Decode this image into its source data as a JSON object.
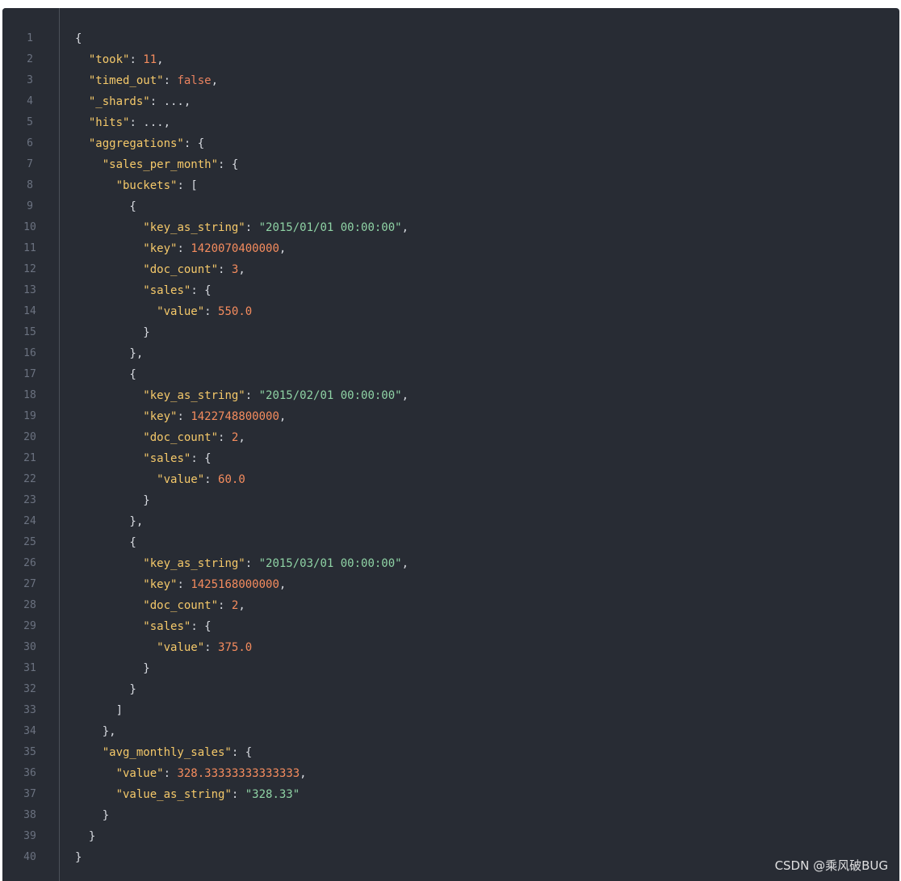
{
  "code_block": {
    "lines": [
      [
        {
          "t": "{",
          "c": "punct"
        }
      ],
      [
        {
          "t": "  ",
          "c": "punct"
        },
        {
          "t": "\"took\"",
          "c": "key"
        },
        {
          "t": ": ",
          "c": "punct"
        },
        {
          "t": "11",
          "c": "num"
        },
        {
          "t": ",",
          "c": "punct"
        }
      ],
      [
        {
          "t": "  ",
          "c": "punct"
        },
        {
          "t": "\"timed_out\"",
          "c": "key"
        },
        {
          "t": ": ",
          "c": "punct"
        },
        {
          "t": "false",
          "c": "bool"
        },
        {
          "t": ",",
          "c": "punct"
        }
      ],
      [
        {
          "t": "  ",
          "c": "punct"
        },
        {
          "t": "\"_shards\"",
          "c": "key"
        },
        {
          "t": ": ...,",
          "c": "punct"
        }
      ],
      [
        {
          "t": "  ",
          "c": "punct"
        },
        {
          "t": "\"hits\"",
          "c": "key"
        },
        {
          "t": ": ...,",
          "c": "punct"
        }
      ],
      [
        {
          "t": "  ",
          "c": "punct"
        },
        {
          "t": "\"aggregations\"",
          "c": "key"
        },
        {
          "t": ": {",
          "c": "punct"
        }
      ],
      [
        {
          "t": "    ",
          "c": "punct"
        },
        {
          "t": "\"sales_per_month\"",
          "c": "key"
        },
        {
          "t": ": {",
          "c": "punct"
        }
      ],
      [
        {
          "t": "      ",
          "c": "punct"
        },
        {
          "t": "\"buckets\"",
          "c": "key"
        },
        {
          "t": ": [",
          "c": "punct"
        }
      ],
      [
        {
          "t": "        {",
          "c": "punct"
        }
      ],
      [
        {
          "t": "          ",
          "c": "punct"
        },
        {
          "t": "\"key_as_string\"",
          "c": "key"
        },
        {
          "t": ": ",
          "c": "punct"
        },
        {
          "t": "\"2015/01/01 00:00:00\"",
          "c": "str"
        },
        {
          "t": ",",
          "c": "punct"
        }
      ],
      [
        {
          "t": "          ",
          "c": "punct"
        },
        {
          "t": "\"key\"",
          "c": "key"
        },
        {
          "t": ": ",
          "c": "punct"
        },
        {
          "t": "1420070400000",
          "c": "num"
        },
        {
          "t": ",",
          "c": "punct"
        }
      ],
      [
        {
          "t": "          ",
          "c": "punct"
        },
        {
          "t": "\"doc_count\"",
          "c": "key"
        },
        {
          "t": ": ",
          "c": "punct"
        },
        {
          "t": "3",
          "c": "num"
        },
        {
          "t": ",",
          "c": "punct"
        }
      ],
      [
        {
          "t": "          ",
          "c": "punct"
        },
        {
          "t": "\"sales\"",
          "c": "key"
        },
        {
          "t": ": {",
          "c": "punct"
        }
      ],
      [
        {
          "t": "            ",
          "c": "punct"
        },
        {
          "t": "\"value\"",
          "c": "key"
        },
        {
          "t": ": ",
          "c": "punct"
        },
        {
          "t": "550.0",
          "c": "num"
        }
      ],
      [
        {
          "t": "          }",
          "c": "punct"
        }
      ],
      [
        {
          "t": "        },",
          "c": "punct"
        }
      ],
      [
        {
          "t": "        {",
          "c": "punct"
        }
      ],
      [
        {
          "t": "          ",
          "c": "punct"
        },
        {
          "t": "\"key_as_string\"",
          "c": "key"
        },
        {
          "t": ": ",
          "c": "punct"
        },
        {
          "t": "\"2015/02/01 00:00:00\"",
          "c": "str"
        },
        {
          "t": ",",
          "c": "punct"
        }
      ],
      [
        {
          "t": "          ",
          "c": "punct"
        },
        {
          "t": "\"key\"",
          "c": "key"
        },
        {
          "t": ": ",
          "c": "punct"
        },
        {
          "t": "1422748800000",
          "c": "num"
        },
        {
          "t": ",",
          "c": "punct"
        }
      ],
      [
        {
          "t": "          ",
          "c": "punct"
        },
        {
          "t": "\"doc_count\"",
          "c": "key"
        },
        {
          "t": ": ",
          "c": "punct"
        },
        {
          "t": "2",
          "c": "num"
        },
        {
          "t": ",",
          "c": "punct"
        }
      ],
      [
        {
          "t": "          ",
          "c": "punct"
        },
        {
          "t": "\"sales\"",
          "c": "key"
        },
        {
          "t": ": {",
          "c": "punct"
        }
      ],
      [
        {
          "t": "            ",
          "c": "punct"
        },
        {
          "t": "\"value\"",
          "c": "key"
        },
        {
          "t": ": ",
          "c": "punct"
        },
        {
          "t": "60.0",
          "c": "num"
        }
      ],
      [
        {
          "t": "          }",
          "c": "punct"
        }
      ],
      [
        {
          "t": "        },",
          "c": "punct"
        }
      ],
      [
        {
          "t": "        {",
          "c": "punct"
        }
      ],
      [
        {
          "t": "          ",
          "c": "punct"
        },
        {
          "t": "\"key_as_string\"",
          "c": "key"
        },
        {
          "t": ": ",
          "c": "punct"
        },
        {
          "t": "\"2015/03/01 00:00:00\"",
          "c": "str"
        },
        {
          "t": ",",
          "c": "punct"
        }
      ],
      [
        {
          "t": "          ",
          "c": "punct"
        },
        {
          "t": "\"key\"",
          "c": "key"
        },
        {
          "t": ": ",
          "c": "punct"
        },
        {
          "t": "1425168000000",
          "c": "num"
        },
        {
          "t": ",",
          "c": "punct"
        }
      ],
      [
        {
          "t": "          ",
          "c": "punct"
        },
        {
          "t": "\"doc_count\"",
          "c": "key"
        },
        {
          "t": ": ",
          "c": "punct"
        },
        {
          "t": "2",
          "c": "num"
        },
        {
          "t": ",",
          "c": "punct"
        }
      ],
      [
        {
          "t": "          ",
          "c": "punct"
        },
        {
          "t": "\"sales\"",
          "c": "key"
        },
        {
          "t": ": {",
          "c": "punct"
        }
      ],
      [
        {
          "t": "            ",
          "c": "punct"
        },
        {
          "t": "\"value\"",
          "c": "key"
        },
        {
          "t": ": ",
          "c": "punct"
        },
        {
          "t": "375.0",
          "c": "num"
        }
      ],
      [
        {
          "t": "          }",
          "c": "punct"
        }
      ],
      [
        {
          "t": "        }",
          "c": "punct"
        }
      ],
      [
        {
          "t": "      ]",
          "c": "punct"
        }
      ],
      [
        {
          "t": "    },",
          "c": "punct"
        }
      ],
      [
        {
          "t": "    ",
          "c": "punct"
        },
        {
          "t": "\"avg_monthly_sales\"",
          "c": "key"
        },
        {
          "t": ": {",
          "c": "punct"
        }
      ],
      [
        {
          "t": "      ",
          "c": "punct"
        },
        {
          "t": "\"value\"",
          "c": "key"
        },
        {
          "t": ": ",
          "c": "punct"
        },
        {
          "t": "328.33333333333333",
          "c": "num"
        },
        {
          "t": ",",
          "c": "punct"
        }
      ],
      [
        {
          "t": "      ",
          "c": "punct"
        },
        {
          "t": "\"value_as_string\"",
          "c": "key"
        },
        {
          "t": ": ",
          "c": "punct"
        },
        {
          "t": "\"328.33\"",
          "c": "str"
        }
      ],
      [
        {
          "t": "    }",
          "c": "punct"
        }
      ],
      [
        {
          "t": "  }",
          "c": "punct"
        }
      ],
      [
        {
          "t": "}",
          "c": "punct"
        }
      ]
    ]
  },
  "watermark": "CSDN @乘风破BUG",
  "colors": {
    "background": "#282c34",
    "gutter_text": "#6b7280",
    "key": "#f5c96a",
    "number": "#f58c5e",
    "string": "#8fd3a5",
    "punctuation": "#d7dae0"
  }
}
